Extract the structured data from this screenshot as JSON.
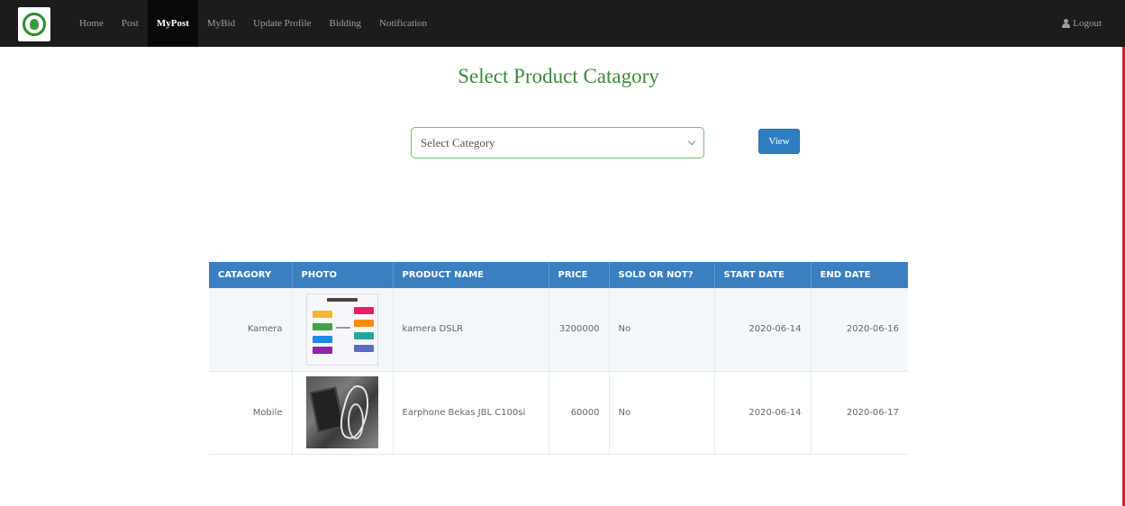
{
  "nav": {
    "items": [
      {
        "label": "Home",
        "active": false
      },
      {
        "label": "Post",
        "active": false
      },
      {
        "label": "MyPost",
        "active": true
      },
      {
        "label": "MyBid",
        "active": false
      },
      {
        "label": "Update Profile",
        "active": false
      },
      {
        "label": "Bidding",
        "active": false
      },
      {
        "label": "Notification",
        "active": false
      }
    ],
    "logout_label": "Logout",
    "logout_icon": "user-icon",
    "logo_icon": "leaf-logo-icon"
  },
  "main": {
    "title": "Select Product Catagory",
    "select": {
      "selected": "Select Category",
      "icon": "chevron-down-icon"
    },
    "view_button": "View"
  },
  "table": {
    "headers": [
      "CATAGORY",
      "PHOTO",
      "PRODUCT NAME",
      "PRICE",
      "SOLD OR NOT?",
      "START DATE",
      "END DATE"
    ],
    "rows": [
      {
        "category": "Kamera",
        "photo": "diagram-thumbnail",
        "product_name": "kamera DSLR",
        "price": "3200000",
        "sold": "No",
        "start_date": "2020-06-14",
        "end_date": "2020-06-16"
      },
      {
        "category": "Mobile",
        "photo": "earphone-photo",
        "product_name": "Earphone Bekas JBL C100si",
        "price": "60000",
        "sold": "No",
        "start_date": "2020-06-14",
        "end_date": "2020-06-17"
      }
    ]
  },
  "colors": {
    "navbar_bg": "#1c1c1c",
    "title_green": "#3a8a3a",
    "table_header": "#3a7fc0",
    "button_blue": "#2e7fc1",
    "right_border": "#c62828"
  }
}
